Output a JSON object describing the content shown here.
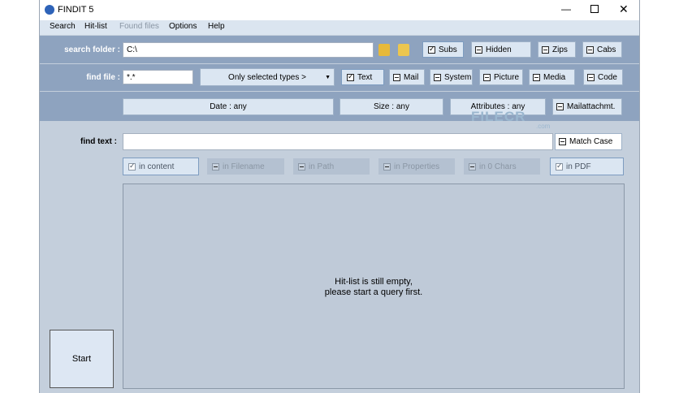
{
  "window": {
    "title": "FINDIT 5"
  },
  "menu": [
    "Search",
    "Hit-list",
    "Found files",
    "Options",
    "Help"
  ],
  "search_folder": {
    "label": "search folder :",
    "value": "C:\\"
  },
  "folder_options": [
    {
      "label": "Subs",
      "checked": true
    },
    {
      "label": "Hidden",
      "checked": false
    },
    {
      "label": "Zips",
      "checked": false
    },
    {
      "label": "Cabs",
      "checked": false
    }
  ],
  "find_file": {
    "label": "find file :",
    "value": "*.*",
    "types_dropdown": "Only selected types >"
  },
  "type_options": [
    {
      "label": "Text",
      "checked": true
    },
    {
      "label": "Mail",
      "checked": false
    },
    {
      "label": "System",
      "checked": false
    },
    {
      "label": "Picture",
      "checked": false
    },
    {
      "label": "Media",
      "checked": false
    },
    {
      "label": "Code",
      "checked": false
    }
  ],
  "filters": {
    "date": "Date : any",
    "size": "Size : any",
    "attributes": "Attributes : any",
    "mail_attach": "Mailattachmt."
  },
  "find_text": {
    "label": "find text :",
    "value": "",
    "match_case": "Match Case"
  },
  "match_options": [
    {
      "label": "in content",
      "checked": true,
      "enabled": true
    },
    {
      "label": "in Filename",
      "checked": false,
      "enabled": false
    },
    {
      "label": "in Path",
      "checked": false,
      "enabled": false
    },
    {
      "label": "in Properties",
      "checked": false,
      "enabled": false
    },
    {
      "label": "in 0 Chars",
      "checked": false,
      "enabled": false
    },
    {
      "label": "in PDF",
      "checked": true,
      "enabled": true
    }
  ],
  "hitlist": {
    "line1": "Hit-list is still empty,",
    "line2": "please start a query first."
  },
  "start_label": "Start",
  "watermark": {
    "text": "FILECR",
    "sub": ".com"
  }
}
